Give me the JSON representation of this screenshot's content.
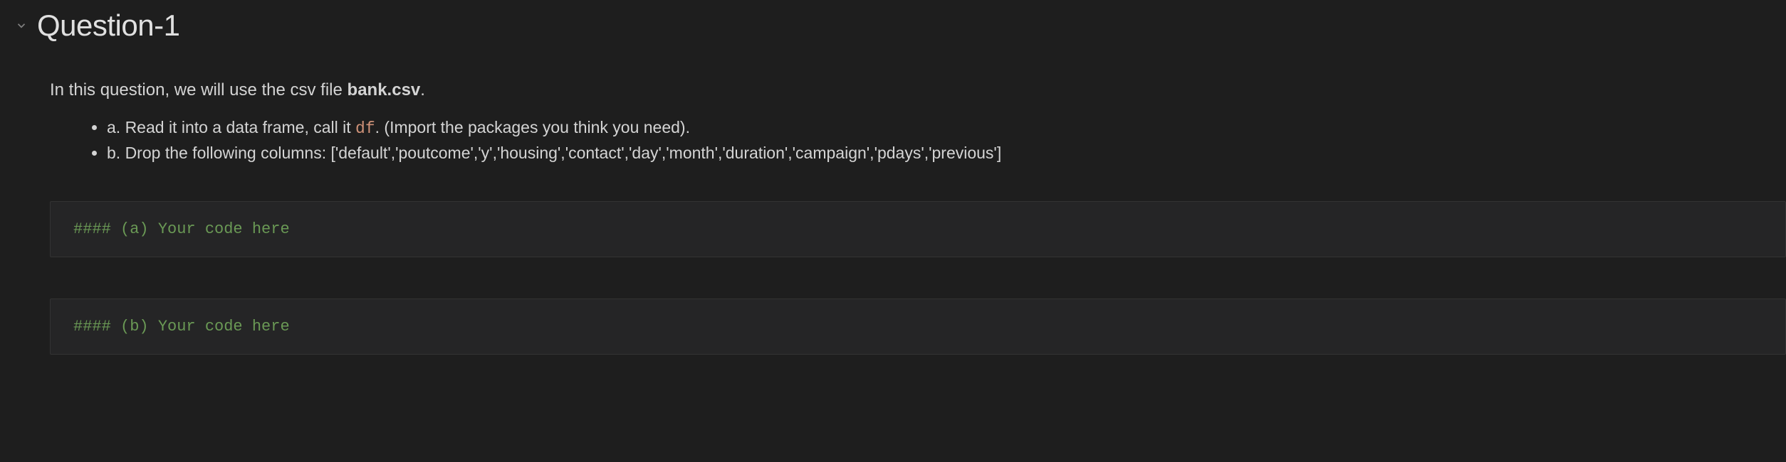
{
  "section": {
    "title": "Question-1"
  },
  "intro": {
    "prefix": "In this question, we will use the csv file ",
    "filename": "bank.csv",
    "suffix": "."
  },
  "bullets": {
    "a": {
      "prefix": "a. Read it into a data frame, call it ",
      "code": "df",
      "suffix": ". (Import the packages you think you need)."
    },
    "b": {
      "text": "b. Drop the following columns: ['default','poutcome','y','housing','contact','day','month','duration','campaign','pdays','previous']"
    }
  },
  "code_cells": {
    "a": "#### (a) Your code here",
    "b": "#### (b) Your code here"
  }
}
